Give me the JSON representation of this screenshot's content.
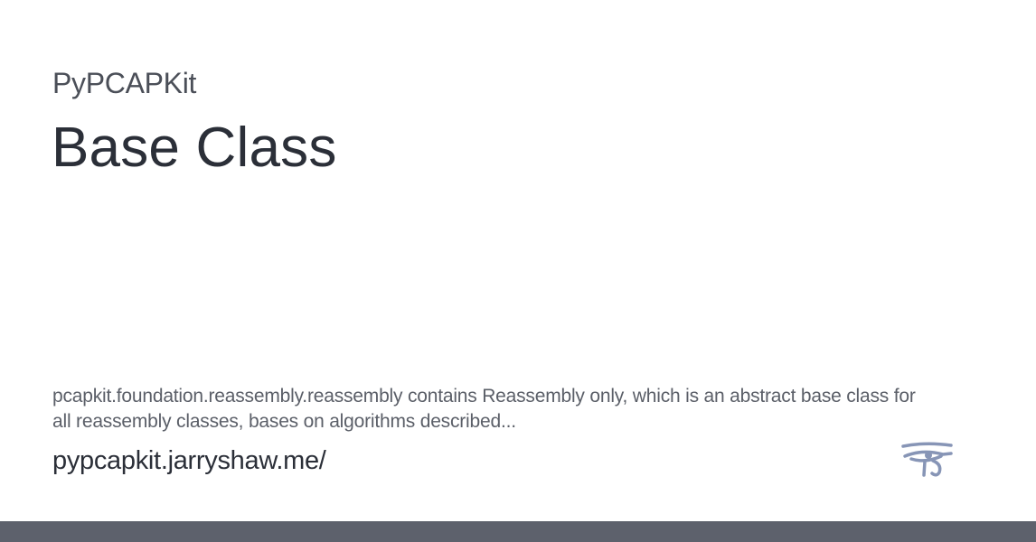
{
  "site": {
    "name": "PyPCAPKit",
    "url": "pypcapkit.jarryshaw.me/"
  },
  "page": {
    "title": "Base Class",
    "description": "pcapkit.foundation.reassembly.reassembly contains Reassembly only, which is an abstract base class for all reassembly classes, bases on algorithms described..."
  },
  "logo": {
    "icon": "eye-of-horus-icon",
    "color": "#8795b6"
  },
  "colors": {
    "title": "#2b2f38",
    "text": "#5b5f68",
    "bottom_bar": "#5d616c"
  }
}
